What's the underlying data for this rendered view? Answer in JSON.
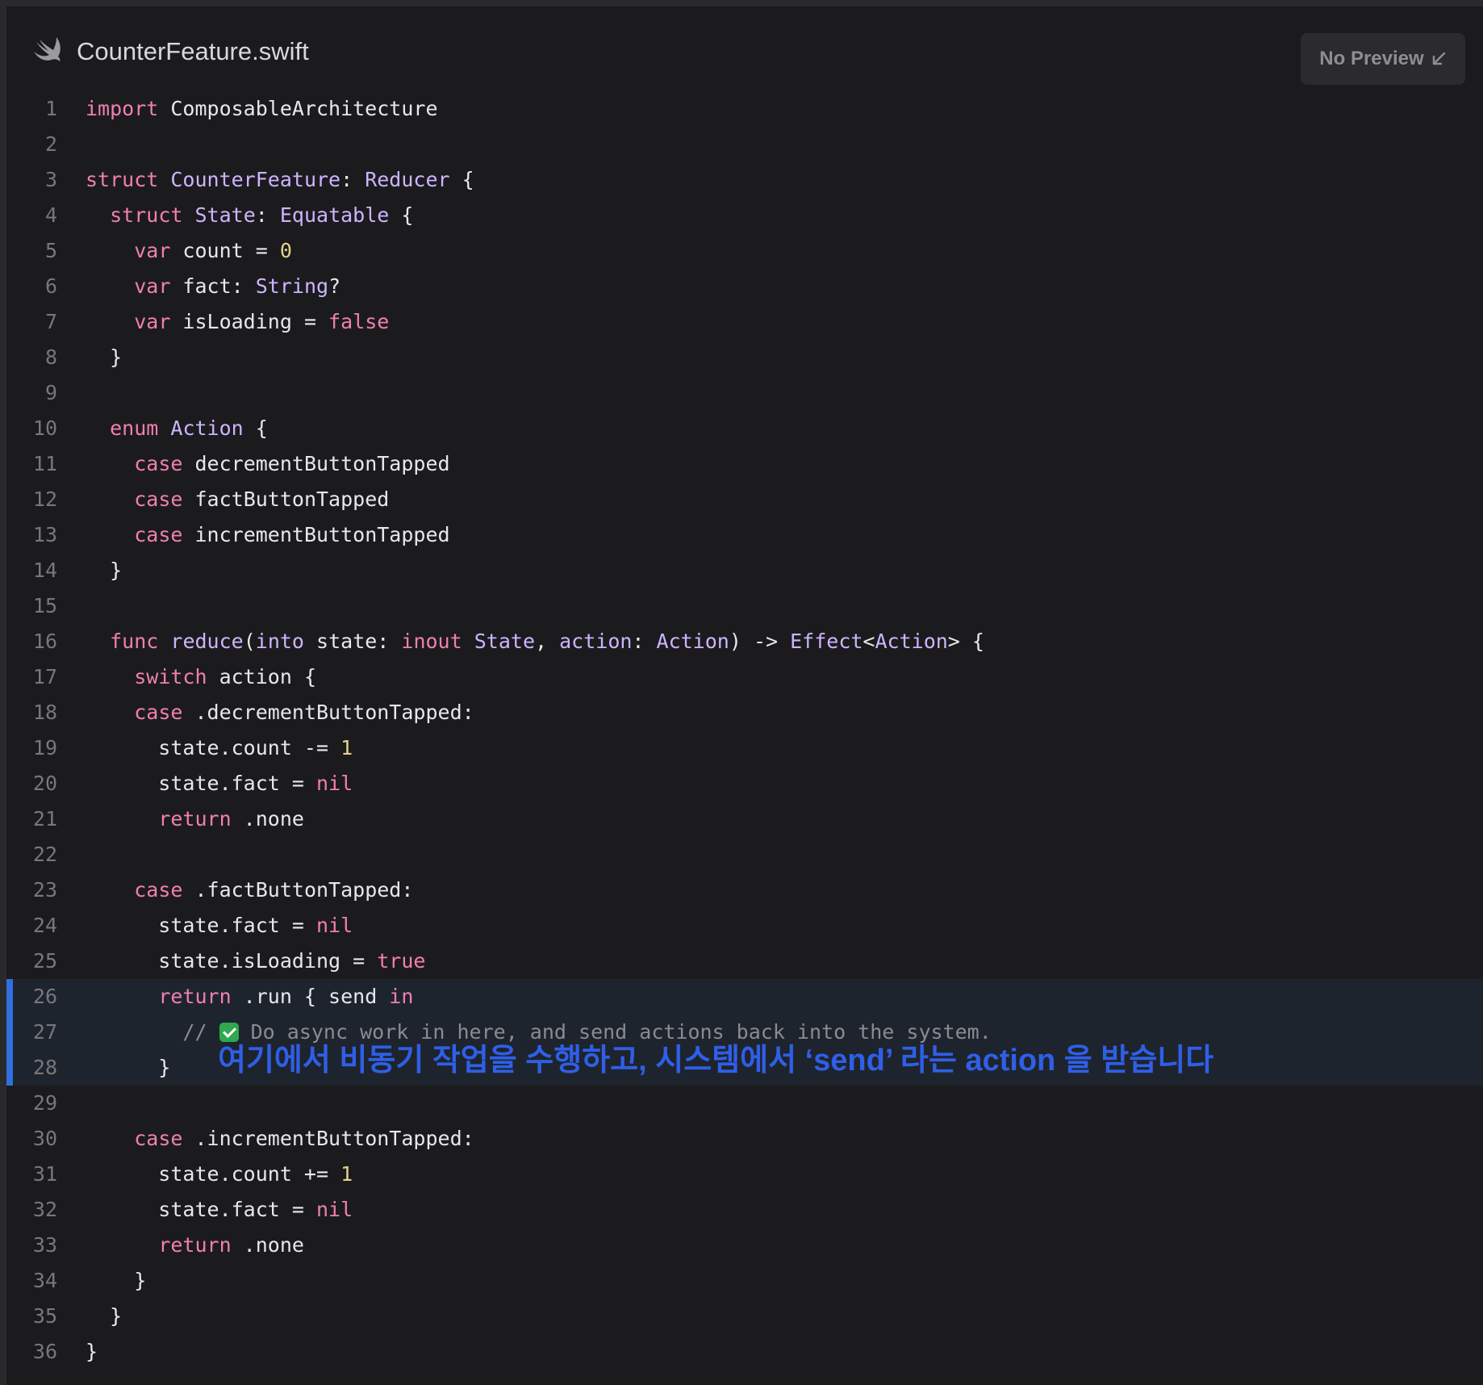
{
  "file": {
    "name": "CounterFeature.swift",
    "icon": "swift-logo-icon"
  },
  "preview_button": {
    "label": "No Preview",
    "icon": "arrow-down-left-icon"
  },
  "annotation": "여기에서 비동기 작업을 수행하고, 시스템에서 ‘send’ 라는 action 을 받습니다",
  "colors": {
    "background": "#1b1b1d",
    "keyword": "#f17fb1",
    "type": "#cdb4ff",
    "number": "#e6d38a",
    "comment": "#8b8b90",
    "highlight_bar": "#2f6fe0",
    "annotation": "#2f5fe8"
  },
  "highlighted_lines": [
    26,
    27,
    28
  ],
  "code_lines": [
    {
      "n": "1",
      "text": "import ComposableArchitecture"
    },
    {
      "n": "2",
      "text": ""
    },
    {
      "n": "3",
      "text": "struct CounterFeature: Reducer {"
    },
    {
      "n": "4",
      "text": "  struct State: Equatable {"
    },
    {
      "n": "5",
      "text": "    var count = 0"
    },
    {
      "n": "6",
      "text": "    var fact: String?"
    },
    {
      "n": "7",
      "text": "    var isLoading = false"
    },
    {
      "n": "8",
      "text": "  }"
    },
    {
      "n": "9",
      "text": ""
    },
    {
      "n": "10",
      "text": "  enum Action {"
    },
    {
      "n": "11",
      "text": "    case decrementButtonTapped"
    },
    {
      "n": "12",
      "text": "    case factButtonTapped"
    },
    {
      "n": "13",
      "text": "    case incrementButtonTapped"
    },
    {
      "n": "14",
      "text": "  }"
    },
    {
      "n": "15",
      "text": ""
    },
    {
      "n": "16",
      "text": "  func reduce(into state: inout State, action: Action) -> Effect<Action> {"
    },
    {
      "n": "17",
      "text": "    switch action {"
    },
    {
      "n": "18",
      "text": "    case .decrementButtonTapped:"
    },
    {
      "n": "19",
      "text": "      state.count -= 1"
    },
    {
      "n": "20",
      "text": "      state.fact = nil"
    },
    {
      "n": "21",
      "text": "      return .none"
    },
    {
      "n": "22",
      "text": ""
    },
    {
      "n": "23",
      "text": "    case .factButtonTapped:"
    },
    {
      "n": "24",
      "text": "      state.fact = nil"
    },
    {
      "n": "25",
      "text": "      state.isLoading = true"
    },
    {
      "n": "26",
      "text": "      return .run { send in"
    },
    {
      "n": "27",
      "text": "        // ✅ Do async work in here, and send actions back into the system."
    },
    {
      "n": "28",
      "text": "      }"
    },
    {
      "n": "29",
      "text": ""
    },
    {
      "n": "30",
      "text": "    case .incrementButtonTapped:"
    },
    {
      "n": "31",
      "text": "      state.count += 1"
    },
    {
      "n": "32",
      "text": "      state.fact = nil"
    },
    {
      "n": "33",
      "text": "      return .none"
    },
    {
      "n": "34",
      "text": "    }"
    },
    {
      "n": "35",
      "text": "  }"
    },
    {
      "n": "36",
      "text": "}"
    }
  ]
}
